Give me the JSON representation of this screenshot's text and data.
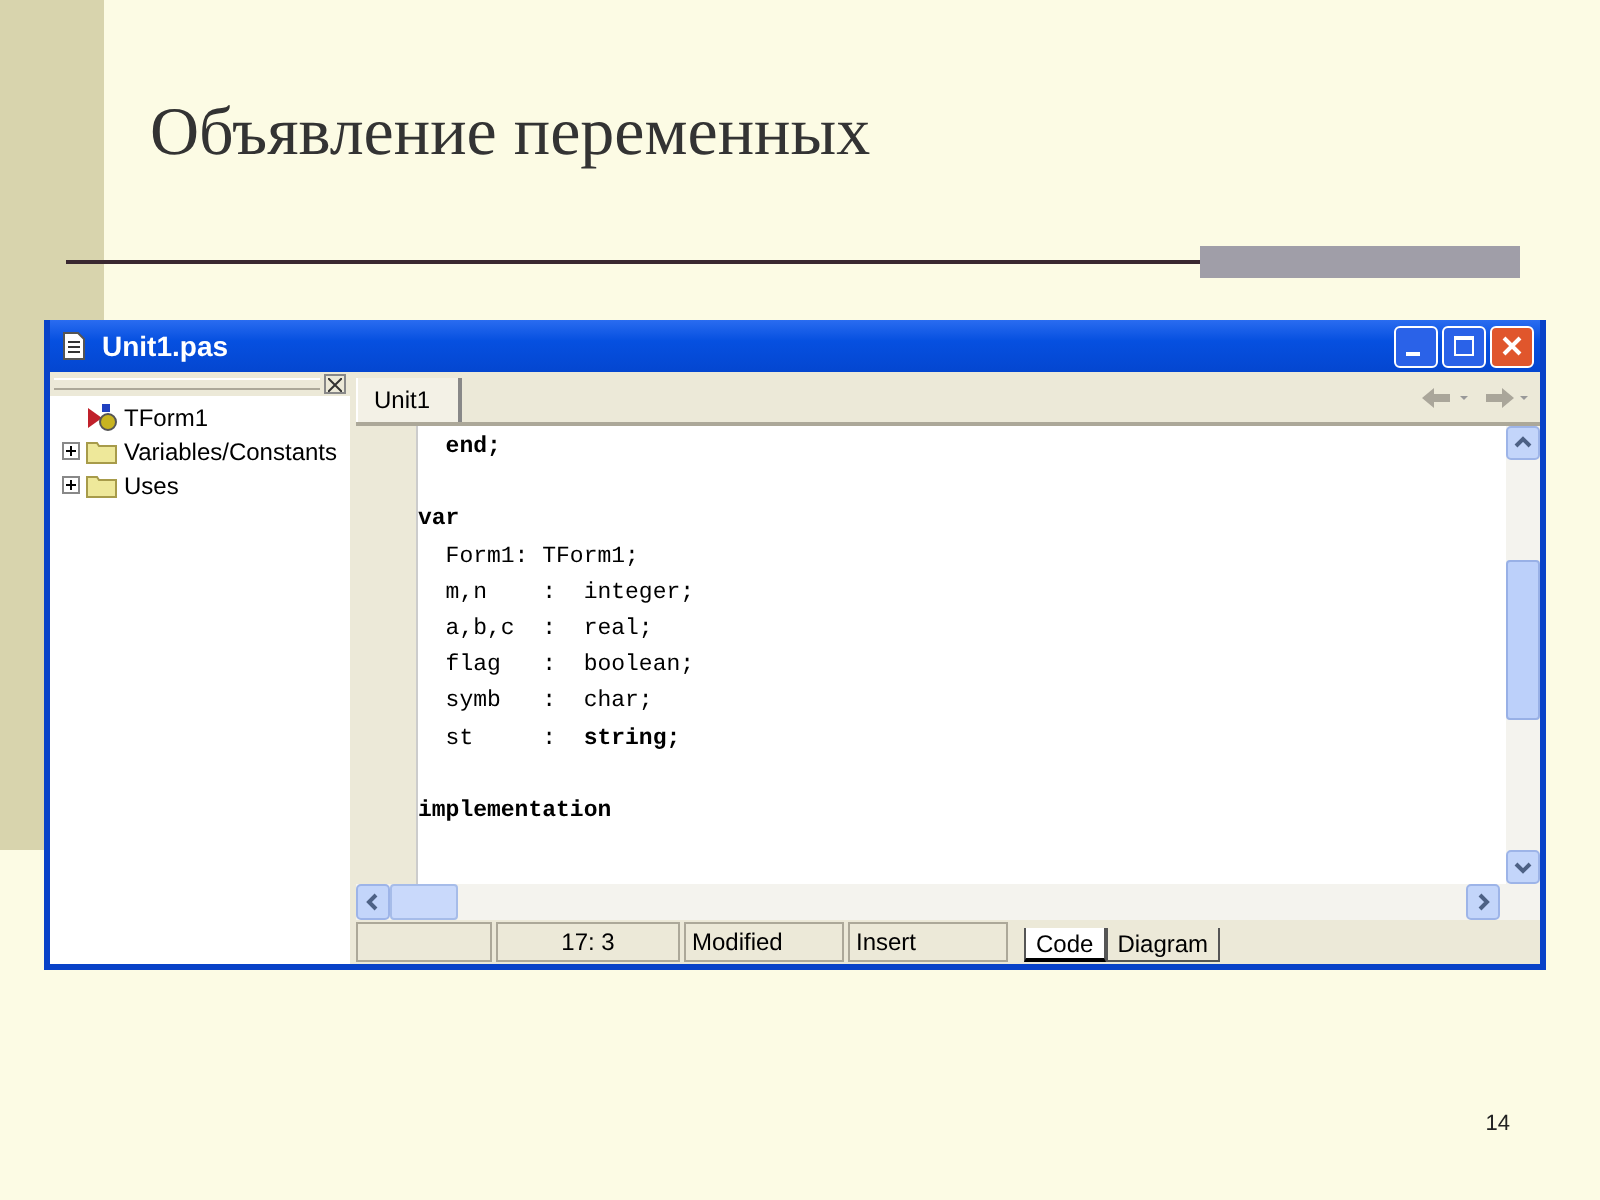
{
  "slide": {
    "title": "Объявление переменных",
    "page_number": "14"
  },
  "window": {
    "title": "Unit1.pas"
  },
  "explorer": {
    "items": [
      {
        "label": "TForm1",
        "kind": "form"
      },
      {
        "label": "Variables/Constants",
        "kind": "folder",
        "expanded": false
      },
      {
        "label": "Uses",
        "kind": "folder",
        "expanded": false
      }
    ]
  },
  "editor_tabs": [
    {
      "label": "Unit1",
      "selected": true
    }
  ],
  "code_lines": [
    {
      "kind": "code",
      "text": "  end;",
      "bold": true
    },
    {
      "kind": "blank"
    },
    {
      "kind": "code",
      "text": "var",
      "bold": true
    },
    {
      "kind": "code",
      "text": "  Form1: TForm1;",
      "bold": false
    },
    {
      "kind": "code",
      "text": "  m,n    :  integer;",
      "bold": false
    },
    {
      "kind": "code",
      "text": "  a,b,c  :  real;",
      "bold": false
    },
    {
      "kind": "code",
      "text": "  flag   :  boolean;",
      "bold": false
    },
    {
      "kind": "code",
      "text": "  symb   :  char;",
      "bold": false
    },
    {
      "kind": "code",
      "text": "  st     :  **string;**",
      "bold": false
    },
    {
      "kind": "blank"
    },
    {
      "kind": "code",
      "text": "implementation",
      "bold": true
    }
  ],
  "status_bar": {
    "position": "17:  3",
    "modified": "Modified",
    "mode": "Insert"
  },
  "view_tabs": [
    {
      "label": "Code",
      "selected": true
    },
    {
      "label": "Diagram",
      "selected": false
    }
  ]
}
